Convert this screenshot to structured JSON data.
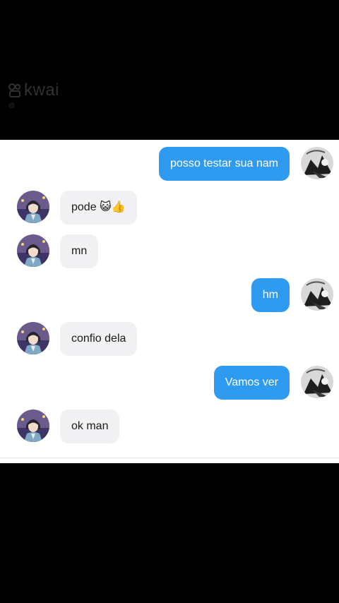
{
  "watermark": {
    "brand": "kwai",
    "handle": "@",
    "line2": ""
  },
  "colors": {
    "sent_bubble": "#2f9bf0",
    "received_bubble": "#f1f1f3",
    "background": "#000000",
    "chat_background": "#ffffff"
  },
  "messages": [
    {
      "side": "sent",
      "text": "posso testar sua nam",
      "avatar": "sender-avatar"
    },
    {
      "side": "received",
      "text": "pode 😺👍",
      "avatar": "contact-avatar"
    },
    {
      "side": "received",
      "text": "mn",
      "avatar": "contact-avatar"
    },
    {
      "side": "sent",
      "text": "hm",
      "avatar": "sender-avatar"
    },
    {
      "side": "received",
      "text": "confio dela",
      "avatar": "contact-avatar"
    },
    {
      "side": "sent",
      "text": "Vamos ver",
      "avatar": "sender-avatar"
    },
    {
      "side": "received",
      "text": "ok man",
      "avatar": "contact-avatar"
    }
  ]
}
